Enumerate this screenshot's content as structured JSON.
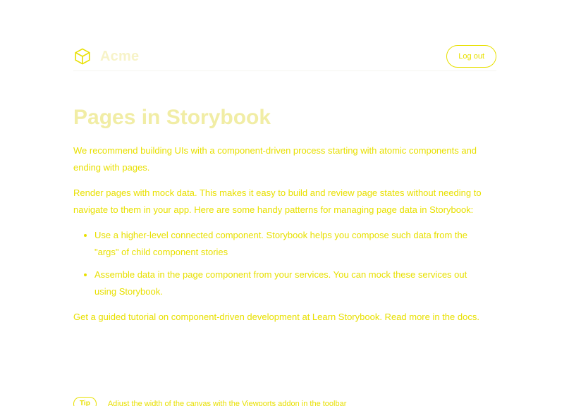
{
  "header": {
    "brand_name": "Acme",
    "login_label": "Log out"
  },
  "main": {
    "title": "Pages in Storybook",
    "paragraphs": [
      "We recommend building UIs with a component-driven process starting with atomic components and ending with pages.",
      "Render pages with mock data. This makes it easy to build and review page states without needing to navigate to them in your app. Here are some handy patterns for managing page data in Storybook:",
      "Get a guided tutorial on component-driven development at Learn Storybook. Read more in the docs."
    ],
    "list_items": [
      "Use a higher-level connected component. Storybook helps you compose such data from the \"args\" of child component stories",
      "Assemble data in the page component from your services. You can mock these services out using Storybook."
    ]
  },
  "tip": {
    "badge": "Tip",
    "text": "Adjust the width of the canvas with the Viewports addon in the toolbar"
  },
  "colors": {
    "accent": "#e8e000",
    "background": "#ffffff",
    "muted": "#f1eda5"
  },
  "icons": {
    "brand": "cube-logo-icon"
  }
}
